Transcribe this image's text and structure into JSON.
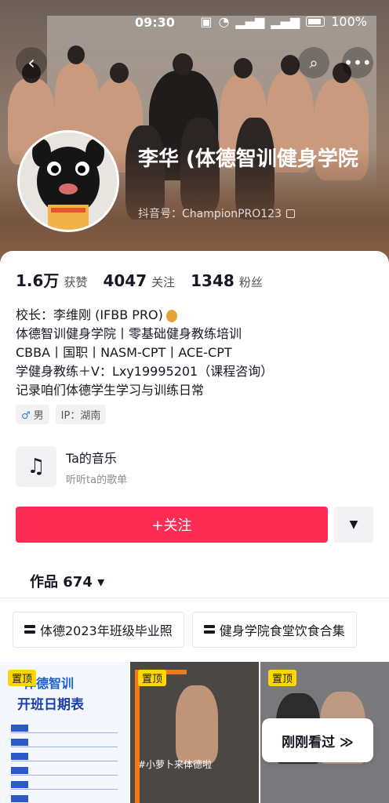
{
  "status_bar": {
    "time": "09:30",
    "battery": "100%"
  },
  "profile": {
    "name": "李华 (体德智训健身学院",
    "douyin_id": "抖音号：ChampionPRO123",
    "stats": [
      {
        "value": "1.6万",
        "label": "获赞"
      },
      {
        "value": "4047",
        "label": "关注"
      },
      {
        "value": "1348",
        "label": "粉丝"
      }
    ],
    "bio": [
      "校长：李维刚 (IFBB PRO)",
      "体德智训健身学院丨零基础健身教练培训",
      "CBBA丨国职丨NASM-CPT丨ACE-CPT",
      "学健身教练＋V：Lxy19995201（课程咨询）",
      "记录咱们体德学生学习与训练日常"
    ],
    "tags": [
      {
        "icon": "male-icon",
        "symbol": "♂",
        "text": "男"
      },
      {
        "text": "IP：湖南"
      }
    ]
  },
  "music": {
    "title": "Ta的音乐",
    "subtitle": "听听ta的歌单"
  },
  "actions": {
    "follow": "+关注",
    "more": "▼"
  },
  "works": {
    "label": "作品 674 ▾"
  },
  "collections": [
    {
      "label": "体德2023年班级毕业照"
    },
    {
      "label": "健身学院食堂饮食合集"
    }
  ],
  "videos": [
    {
      "pin": "置顶",
      "title_line1": "体德智训",
      "title_line2": "开班日期表"
    },
    {
      "pin": "置顶",
      "caption": "#小萝卜来体德啦"
    },
    {
      "pin": "置顶"
    }
  ],
  "recently_watched": "刚刚看过 ≫"
}
